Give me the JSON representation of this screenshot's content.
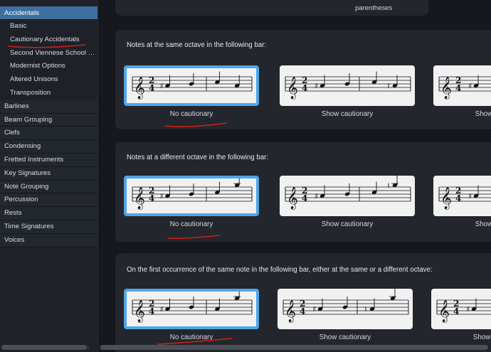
{
  "sidebar": {
    "items": [
      {
        "label": "Accidentals",
        "type": "parent-active"
      },
      {
        "label": "Basic",
        "type": "sub"
      },
      {
        "label": "Cautionary Accidentals",
        "type": "sub"
      },
      {
        "label": "Second Viennese School O...",
        "type": "sub"
      },
      {
        "label": "Modernist Options",
        "type": "sub"
      },
      {
        "label": "Altered Unisons",
        "type": "sub"
      },
      {
        "label": "Transposition",
        "type": "sub"
      },
      {
        "label": "Barlines",
        "type": "item"
      },
      {
        "label": "Beam Grouping",
        "type": "item"
      },
      {
        "label": "Clefs",
        "type": "item"
      },
      {
        "label": "Condensing",
        "type": "item"
      },
      {
        "label": "Fretted Instruments",
        "type": "item"
      },
      {
        "label": "Key Signatures",
        "type": "item"
      },
      {
        "label": "Note Grouping",
        "type": "item"
      },
      {
        "label": "Percussion",
        "type": "item"
      },
      {
        "label": "Rests",
        "type": "item"
      },
      {
        "label": "Time Signatures",
        "type": "item"
      },
      {
        "label": "Voices",
        "type": "item"
      }
    ]
  },
  "main": {
    "top_fragment": {
      "dot1": ")",
      "dot2": ")",
      "text": "parentheses"
    },
    "sections": [
      {
        "title": "Notes at the same octave in the following bar:",
        "options": [
          {
            "label": "No cautionary",
            "selected": true
          },
          {
            "label": "Show cautionary",
            "selected": false
          },
          {
            "label": "Show cautionary",
            "selected": false
          }
        ]
      },
      {
        "title": "Notes at a different octave in the following bar:",
        "options": [
          {
            "label": "No cautionary",
            "selected": true
          },
          {
            "label": "Show cautionary",
            "selected": false
          },
          {
            "label": "Show cautionary",
            "selected": false
          }
        ]
      },
      {
        "title": "On the first occurrence of the same note in the following bar, either at the same or a different octave:",
        "options": [
          {
            "label": "No cautionary",
            "selected": true
          },
          {
            "label": "Show cautionary",
            "selected": false
          },
          {
            "label": "Show cautionary",
            "selected": false
          }
        ]
      }
    ]
  },
  "notation": {
    "time_signature_top": "2",
    "time_signature_bottom": "4",
    "clef_icon": "treble-clef-icon",
    "sharp_glyph": "♯",
    "natural_glyph": "♮",
    "clef_glyph": "𝄞"
  },
  "colors": {
    "accent_selected": "#4ea5e8",
    "sidebar_active": "#3f6f9e",
    "annotation_red": "#d0201a"
  }
}
